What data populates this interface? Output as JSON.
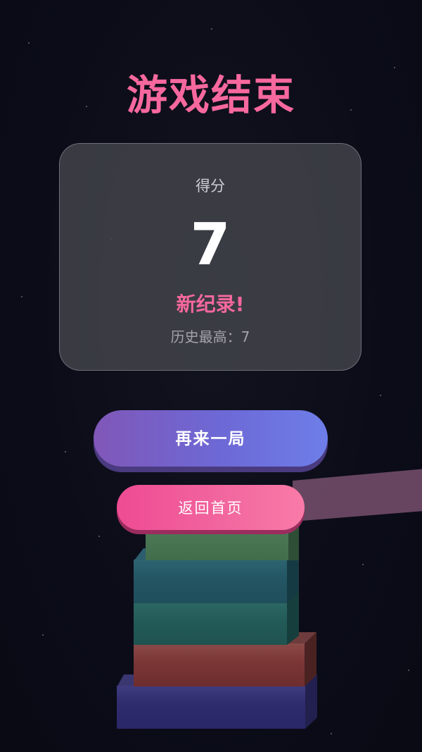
{
  "game_over": {
    "title": "游戏结束",
    "score_label": "得分",
    "score": "7",
    "new_record": "新纪录!",
    "best_label": "历史最高：7"
  },
  "buttons": {
    "play_again": "再来一局",
    "home": "返回首页"
  },
  "colors": {
    "accent_pink": "#f7689e",
    "card_bg": "#46484e",
    "button_purple_start": "#8057b8",
    "button_purple_end": "#6e7ee8",
    "button_pink_start": "#ee4b93",
    "button_pink_end": "#f97ba8"
  },
  "tower_blocks": [
    {
      "color": "indigo"
    },
    {
      "color": "red"
    },
    {
      "color": "teal-green"
    },
    {
      "color": "teal-blue"
    },
    {
      "color": "green"
    }
  ]
}
